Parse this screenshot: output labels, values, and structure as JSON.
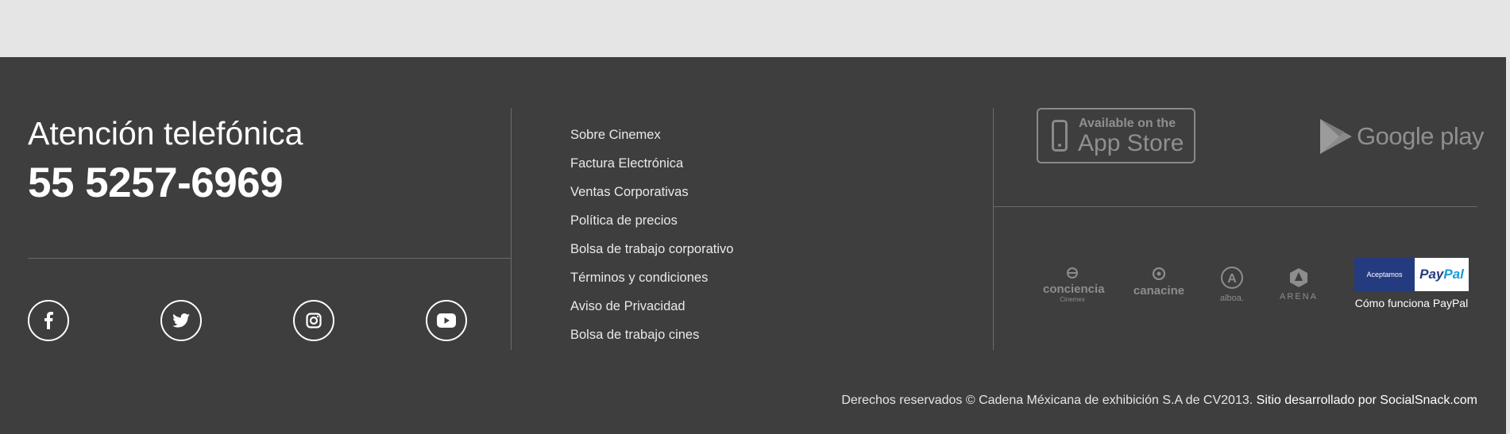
{
  "contact": {
    "title": "Atención telefónica",
    "phone": "55 5257-6969"
  },
  "social": [
    {
      "name": "facebook-icon",
      "glyph": "f"
    },
    {
      "name": "twitter-icon"
    },
    {
      "name": "instagram-icon"
    },
    {
      "name": "youtube-icon"
    }
  ],
  "links": [
    "Sobre Cinemex",
    "Factura Electrónica",
    "Ventas Corporativas",
    "Política de precios",
    "Bolsa de trabajo corporativo",
    "Términos y condiciones",
    "Aviso de Privacidad",
    "Bolsa de trabajo cines"
  ],
  "apps": {
    "appstore_line1": "Available on the",
    "appstore_line2": "App Store",
    "googleplay": "Google play"
  },
  "partners": [
    {
      "label": "conciencia",
      "sub": "Cinemex"
    },
    {
      "label": "canacine",
      "sub": ""
    },
    {
      "label": "alboa.",
      "sub": ""
    },
    {
      "label": "ARENA",
      "sub": ""
    }
  ],
  "paypal": {
    "badge_left": "Aceptamos",
    "badge_right_a": "Pay",
    "badge_right_b": "Pal",
    "link": "Cómo funciona PayPal"
  },
  "footer": {
    "copyright": "Derechos reservados © Cadena Méxicana de exhibición S.A de CV2013.",
    "developer": "Sitio desarrollado por SocialSnack.com"
  },
  "colors": {
    "footer_bg": "#3e3e3e",
    "page_bg": "#e5e5e5",
    "paypal_blue": "#253b80",
    "paypal_light": "#179bd7"
  }
}
